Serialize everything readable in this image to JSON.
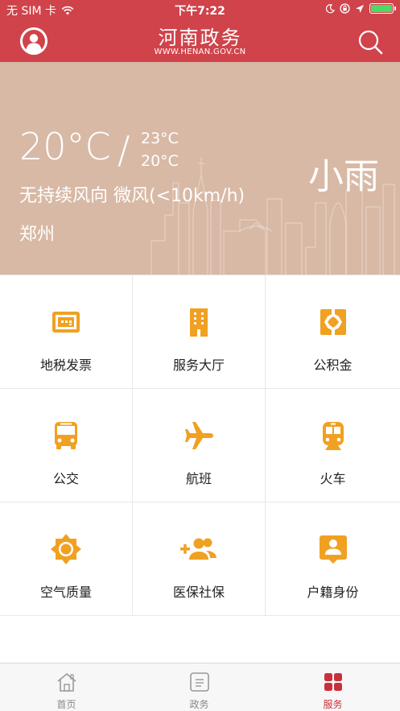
{
  "status_bar": {
    "carrier": "无 SIM 卡",
    "time": "下午7:22",
    "battery_level": 1.0
  },
  "header": {
    "title": "河南政务",
    "subtitle": "WWW.HENAN.GOV.CN"
  },
  "weather": {
    "temperature": "20°C",
    "separator": "/",
    "high": "23°C",
    "low": "20°C",
    "wind": "无持续风向  微风(<10km/h)",
    "city": "郑州",
    "condition": "小雨"
  },
  "services": [
    {
      "label": "地税发票",
      "icon": "invoice-icon"
    },
    {
      "label": "服务大厅",
      "icon": "building-icon"
    },
    {
      "label": "公积金",
      "icon": "fund-icon"
    },
    {
      "label": "公交",
      "icon": "bus-icon"
    },
    {
      "label": "航班",
      "icon": "airplane-icon"
    },
    {
      "label": "火车",
      "icon": "train-icon"
    },
    {
      "label": "空气质量",
      "icon": "sun-icon"
    },
    {
      "label": "医保社保",
      "icon": "add-people-icon"
    },
    {
      "label": "户籍身份",
      "icon": "id-badge-icon"
    }
  ],
  "tabs": [
    {
      "label": "首页",
      "icon": "home-icon",
      "active": false
    },
    {
      "label": "政务",
      "icon": "document-icon",
      "active": false
    },
    {
      "label": "服务",
      "icon": "grid-icon",
      "active": true
    }
  ],
  "colors": {
    "brand_red": "#d0434a",
    "weather_bg": "#d8b9a5",
    "icon_orange": "#f0a122",
    "active_tab": "#c8313a"
  }
}
